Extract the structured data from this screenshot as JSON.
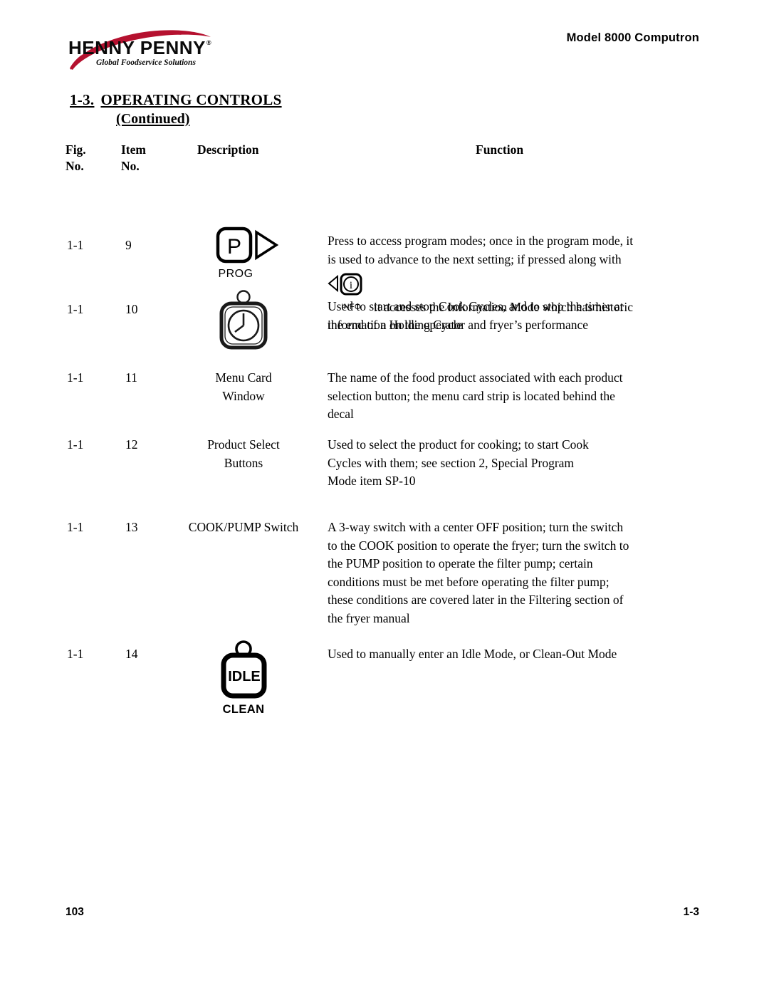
{
  "header": {
    "logo": {
      "name": "HENNY PENNY",
      "registered_mark": "®",
      "tagline": "Global Foodservice Solutions",
      "swoosh_color": "#B5112F"
    },
    "model_label": "Model 8000 Computron"
  },
  "section": {
    "number": "1-3.",
    "title": "OPERATING CONTROLS",
    "continued": "(Continued)"
  },
  "table": {
    "headers": {
      "fig_no_line1": "Fig.",
      "fig_no_line2": "No.",
      "item_no_line1": "Item",
      "item_no_line2": "No.",
      "description": "Description",
      "function": "Function"
    },
    "rows": [
      {
        "fig_no": "1-1",
        "item_no": "9",
        "description_type": "icon",
        "description_icon": "prog-button-icon",
        "icon_text": {
          "letter": "P",
          "label": "PROG"
        },
        "function_lines": [
          "Press to access program modes; once in the program mode, it",
          "is used to advance to the next setting; if pressed along with"
        ],
        "function_inline_icon": {
          "name": "info-button-icon",
          "label": "INFO",
          "glyph": "i"
        },
        "function_lines_after": [
          "it accesses the Information Mode which has historic",
          "information on the operator and fryer’s performance"
        ]
      },
      {
        "fig_no": "1-1",
        "item_no": "10",
        "description_type": "icon",
        "description_icon": "timer-button-icon",
        "function_lines": [
          "Used to start and stop Cook Cycles, and to stop the timer at",
          "the end of a Holding Cycle"
        ]
      },
      {
        "fig_no": "1-1",
        "item_no": "11",
        "description_type": "text",
        "description_lines": [
          "Menu Card",
          "Window"
        ],
        "function_lines": [
          "The name of the food product associated with each product",
          "selection button; the menu card strip is located behind the",
          "decal"
        ]
      },
      {
        "fig_no": "1-1",
        "item_no": "12",
        "description_type": "text",
        "description_lines": [
          "Product Select",
          "Buttons"
        ],
        "function_lines": [
          "Used to select the product for cooking; to start Cook",
          "Cycles with them; see section 2, Special Program",
          "Mode item SP-10"
        ]
      },
      {
        "fig_no": "1-1",
        "item_no": "13",
        "description_type": "text",
        "description_lines": [
          "COOK/PUMP Switch"
        ],
        "function_lines": [
          "A 3-way switch with a center OFF position; turn the switch",
          "to the COOK position to operate the fryer; turn the switch to",
          "the PUMP position to operate the filter pump; certain",
          "conditions must be met before operating the filter pump;",
          "these conditions are covered later in the Filtering section of",
          "the fryer manual"
        ]
      },
      {
        "fig_no": "1-1",
        "item_no": "14",
        "description_type": "icon",
        "description_icon": "idle-clean-button-icon",
        "icon_text": {
          "letter": "IDLE",
          "label": "CLEAN"
        },
        "function_lines": [
          "Used to manually enter an Idle Mode, or Clean-Out Mode"
        ]
      }
    ]
  },
  "footer": {
    "left": "103",
    "right": "1-3"
  }
}
